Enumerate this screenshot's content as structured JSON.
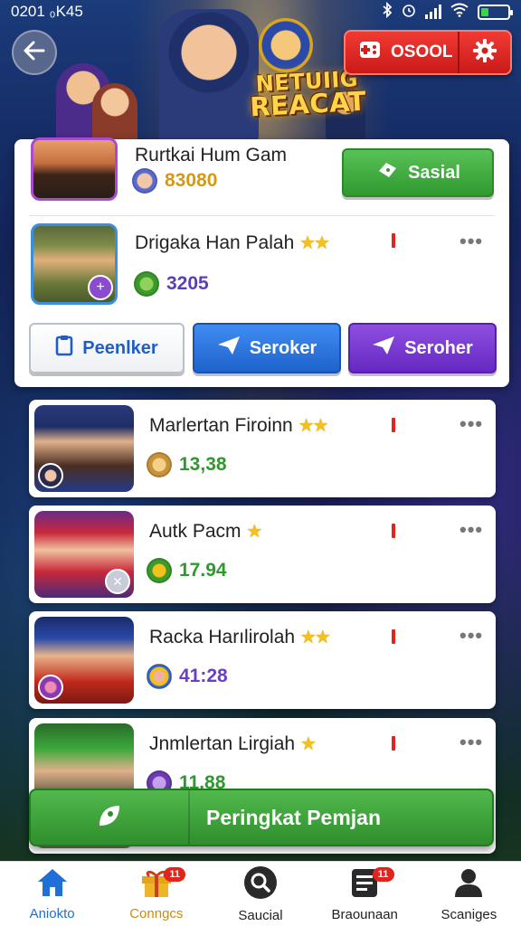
{
  "status_bar": {
    "time": "0201 ₀K45",
    "extra": "ᐡ ᐓ"
  },
  "header": {
    "banner_title_line1": "NETUIIG",
    "banner_title_line2": "REACAT",
    "code_label": "OSOOL"
  },
  "top_card": {
    "player1": {
      "name": "Rurtkai Hum Gam",
      "score": "83080",
      "score_color": "#d49a12"
    },
    "share_button": "Sasial",
    "player2": {
      "name": "Drigaka Han Palah",
      "stars": "★★",
      "score": "3205",
      "score_color": "#5b3fb8"
    },
    "buttons": {
      "white": "Peenlker",
      "blue": "Seroker",
      "purple": "Seroher"
    }
  },
  "rows": [
    {
      "name": "Marlertan Firoinn",
      "stars": "★★",
      "score": "13,38",
      "score_color": "#2e9a2e"
    },
    {
      "name": "Autk Pacm",
      "stars": "★",
      "score": "17.94",
      "score_color": "#2e9a2e"
    },
    {
      "name": "Racka Harılirolah",
      "stars": "★★",
      "score": "41:28",
      "score_color": "#6a3fc8"
    },
    {
      "name": "Jnmlertan Ŀirgiah",
      "stars": "★",
      "score": "11.88",
      "score_color": "#2e9a2e"
    }
  ],
  "cta": {
    "label": "Peringkat Pemjan"
  },
  "nav": [
    {
      "label": "Aniokto",
      "icon": "home-icon",
      "color": "#1f6fd6",
      "badge": ""
    },
    {
      "label": "Conngcs",
      "icon": "gift-icon",
      "color": "#e6a31a",
      "badge": "11"
    },
    {
      "label": "Saucial",
      "icon": "search-icon",
      "color": "#222222",
      "badge": ""
    },
    {
      "label": "Braounaan",
      "icon": "list-icon",
      "color": "#222222",
      "badge": "11"
    },
    {
      "label": "Scaniges",
      "icon": "person-icon",
      "color": "#222222",
      "badge": ""
    }
  ],
  "colors": {
    "accent_green": "#3aa83a",
    "accent_blue": "#2a72de",
    "accent_purple": "#7438d0",
    "accent_red": "#e3241c"
  }
}
